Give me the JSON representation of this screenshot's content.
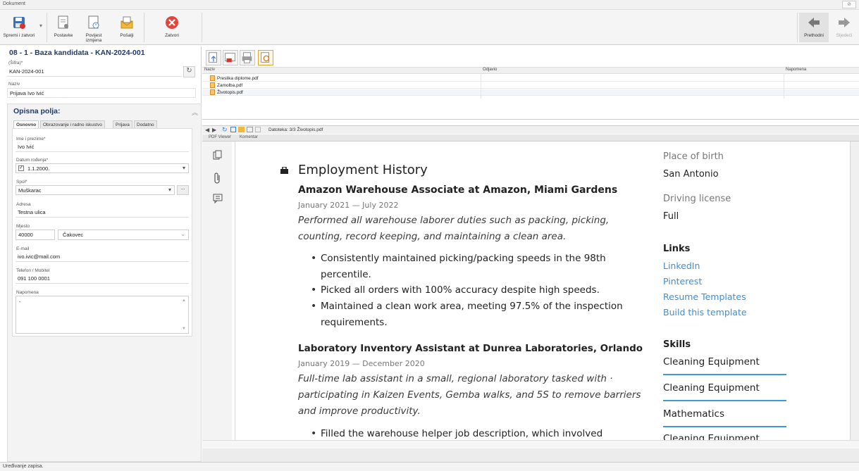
{
  "window": {
    "title": "Dokument"
  },
  "toolbar": {
    "save_close": "Spremi i zatvori",
    "settings": "Postavke",
    "history": "Povijest izmjena",
    "send": "Pošalji",
    "close": "Zatvori",
    "prev": "Prethodni",
    "next": "Sljedeći"
  },
  "record": {
    "title": "08 - 1 - Baza kandidata - KAN-2024-001",
    "code_label": "(Šifra)*",
    "code_value": "KAN-2024-001",
    "name_label": "Naziv",
    "name_value": "Prijava Ivo Ivić"
  },
  "opis": {
    "title": "Opisna polja:",
    "tabs": [
      "Osnovno",
      "Obrazovanje i radno iskustvo",
      "Prijava",
      "Dodatno"
    ],
    "fields": {
      "ime_label": "Ime i prezime*",
      "ime_value": "Ivo Ivić",
      "datum_label": "Datum rođenja*",
      "datum_value": "1.1.2000.",
      "spol_label": "Spol*",
      "spol_value": "Muškarac",
      "adresa_label": "Adresa",
      "adresa_value": "Testna ulica",
      "mjesto_label": "Mjesto",
      "mjesto_zip": "40000",
      "mjesto_city": "Čakovec",
      "email_label": "E-mail",
      "email_value": "ivo.ivic@mail.com",
      "tel_label": "Telefon / Mobitel",
      "tel_value": "091 100 0001",
      "napomena_label": "Napomena",
      "napomena_value": "-"
    }
  },
  "files": {
    "columns": [
      "Naziv",
      "Odjavio",
      "Napomena"
    ],
    "rows": [
      "Preslika diplome.pdf",
      "Zamolba.pdf",
      "Životopis.pdf"
    ]
  },
  "pdf": {
    "file_label": "Datoteka: 3/3  Životopis.pdf",
    "tabs": [
      "PDF Viewer",
      "Komentar"
    ],
    "heading": "Employment History",
    "job1_title": "Amazon Warehouse Associate at Amazon, Miami Gardens",
    "job1_dates": "January 2021 — July 2022",
    "job1_desc1": "Performed all warehouse laborer duties such as packing, picking,",
    "job1_desc2": "counting, record keeping, and maintaining a clean area.",
    "b1a": "Consistently maintained picking/packing speeds in the 98th",
    "b1b": "percentile.",
    "b2": "Picked all orders with 100% accuracy despite high speeds.",
    "b3a": "Maintained a clean work area, meeting 97.5% of the inspection",
    "b3b": "requirements.",
    "job2_title": "Laboratory Inventory Assistant  at  Dunrea Laboratories, Orlando",
    "job2_dates": "January 2019 — December 2020",
    "job2_desc1": "Full-time lab assistant in a small, regional laboratory tasked with ·",
    "job2_desc2": "participating in Kaizen Events, Gemba walks, and 5S to remove barriers",
    "job2_desc3": "and improve productivity.",
    "b4": "Filled the warehouse helper job description, which involved",
    "side": {
      "pob_label": "Place of birth",
      "pob_value": "San Antonio",
      "dl_label": "Driving license",
      "dl_value": "Full",
      "links_title": "Links",
      "links": [
        "LinkedIn",
        "Pinterest",
        "Resume Templates",
        "Build this template"
      ],
      "skills_title": "Skills",
      "skills": [
        "Cleaning Equipment",
        "Cleaning Equipment",
        "Mathematics",
        "Cleaning Equipment"
      ]
    }
  },
  "status": {
    "text": "Uređivanje zapisa."
  }
}
